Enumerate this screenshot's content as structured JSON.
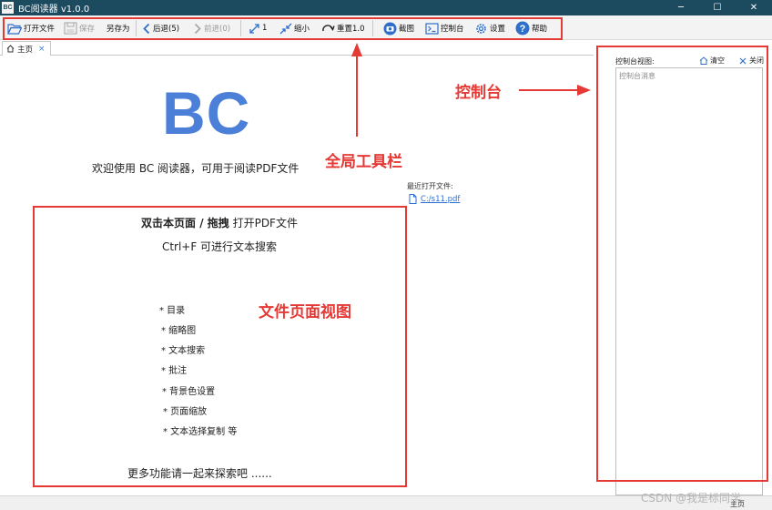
{
  "app": {
    "logo_text": "BC",
    "title": "BC阅读器 v1.0.0"
  },
  "window_controls": {
    "minimize": "─",
    "maximize": "☐",
    "close": "✕"
  },
  "toolbar": {
    "open": "打开文件",
    "save": "保存",
    "save_as": "另存为",
    "back": "后退(5)",
    "forward": "前进(0)",
    "fit": "1",
    "shrink": "缩小",
    "reset": "重置1.0",
    "screenshot": "截图",
    "console": "控制台",
    "settings": "设置",
    "help": "帮助"
  },
  "tabs": [
    {
      "label": "主页",
      "close": "×"
    }
  ],
  "main": {
    "logo": "BC",
    "welcome": "欢迎使用 BC 阅读器，可用于阅读PDF文件",
    "recent_label": "最近打开文件:",
    "recent_files": [
      "C:/s11.pdf"
    ],
    "hint_bold": "双击本页面 / 拖拽",
    "hint_rest": " 打开PDF文件",
    "hint_search": "Ctrl+F 可进行文本搜索",
    "features": [
      "* 目录",
      "* 缩略图",
      "* 文本搜索",
      "* 批注",
      "* 背景色设置",
      "* 页面缩放",
      "* 文本选择复制 等"
    ],
    "more": "更多功能请一起来探索吧 ......"
  },
  "annotations": {
    "toolbar_label": "全局工具栏",
    "doc_view_label": "文件页面视图",
    "console_label": "控制台",
    "color": "#e53935"
  },
  "console": {
    "title": "控制台视图:",
    "clear": "清空",
    "close": "关闭",
    "placeholder": "控制台消息"
  },
  "status": {
    "page": "主页"
  },
  "watermark": "CSDN @我是标同学"
}
